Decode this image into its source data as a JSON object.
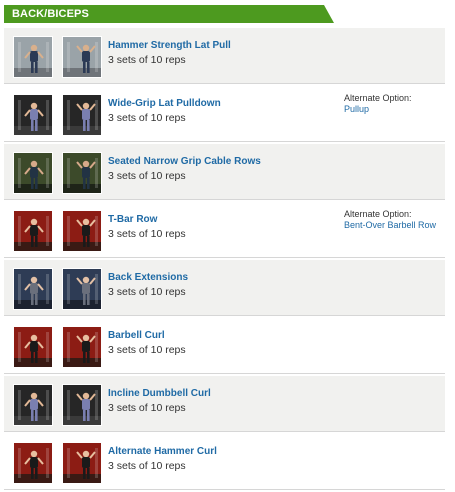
{
  "section": {
    "title": "BACK/BICEPS",
    "color": "#4d9a1f"
  },
  "exercises": [
    {
      "name": "Hammer Strength Lat Pull",
      "sets": "3 sets of 10 reps",
      "scene": "gym-gray",
      "alternate_label": "",
      "alternate_option": ""
    },
    {
      "name": "Wide-Grip Lat Pulldown",
      "sets": "3 sets of 10 reps",
      "scene": "dark",
      "alternate_label": "Alternate Option:",
      "alternate_option": "Pullup"
    },
    {
      "name": "Seated Narrow Grip Cable Rows",
      "sets": "3 sets of 10 reps",
      "scene": "green",
      "alternate_label": "",
      "alternate_option": ""
    },
    {
      "name": "T-Bar Row",
      "sets": "3 sets of 10 reps",
      "scene": "red",
      "alternate_label": "Alternate Option:",
      "alternate_option": "Bent-Over Barbell Row"
    },
    {
      "name": "Back Extensions",
      "sets": "3 sets of 10 reps",
      "scene": "blue",
      "alternate_label": "",
      "alternate_option": ""
    },
    {
      "name": "Barbell Curl",
      "sets": "3 sets of 10 reps",
      "scene": "red",
      "alternate_label": "",
      "alternate_option": ""
    },
    {
      "name": "Incline Dumbbell Curl",
      "sets": "3 sets of 10 reps",
      "scene": "dark",
      "alternate_label": "",
      "alternate_option": ""
    },
    {
      "name": "Alternate Hammer Curl",
      "sets": "3 sets of 10 reps",
      "scene": "red",
      "alternate_label": "",
      "alternate_option": ""
    }
  ]
}
